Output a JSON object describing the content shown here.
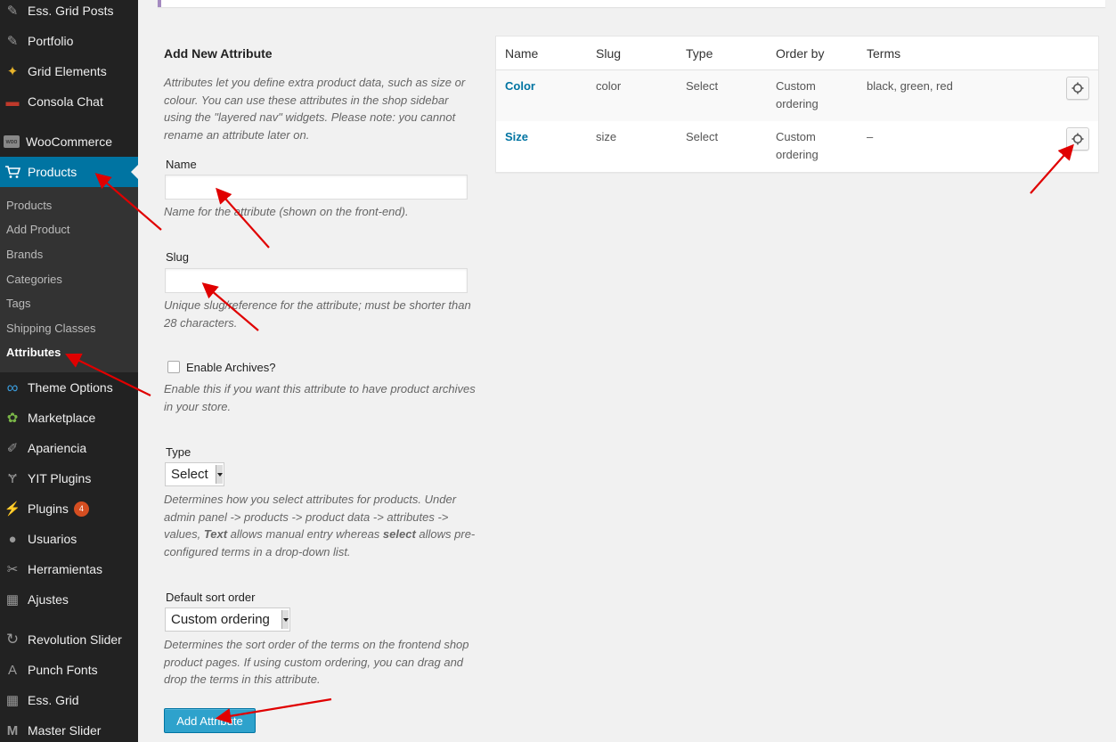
{
  "sidebar": {
    "items": [
      {
        "label": "Ess. Grid Posts",
        "icon": "pin-icon",
        "glyph": "✎"
      },
      {
        "label": "Portfolio",
        "icon": "pin-icon",
        "glyph": "✎"
      },
      {
        "label": "Grid Elements",
        "icon": "grid-elements-icon",
        "glyph": "✦"
      },
      {
        "label": "Consola Chat",
        "icon": "chat-icon",
        "glyph": "▬"
      },
      {
        "label": "WooCommerce",
        "icon": "woocommerce-icon",
        "glyph": "woo"
      },
      {
        "label": "Products",
        "icon": "cart-icon",
        "glyph": "🛒"
      },
      {
        "label": "Theme Options",
        "icon": "theme-options-icon",
        "glyph": "∞"
      },
      {
        "label": "Marketplace",
        "icon": "marketplace-icon",
        "glyph": "✿"
      },
      {
        "label": "Apariencia",
        "icon": "brush-icon",
        "glyph": "✐"
      },
      {
        "label": "YIT Plugins",
        "icon": "yit-icon",
        "glyph": "Ɏ"
      },
      {
        "label": "Plugins",
        "icon": "plugin-icon",
        "glyph": "⚡",
        "badge": "4"
      },
      {
        "label": "Usuarios",
        "icon": "users-icon",
        "glyph": "●"
      },
      {
        "label": "Herramientas",
        "icon": "wrench-icon",
        "glyph": "✂"
      },
      {
        "label": "Ajustes",
        "icon": "settings-icon",
        "glyph": "▦"
      },
      {
        "label": "Revolution Slider",
        "icon": "refresh-icon",
        "glyph": "↻"
      },
      {
        "label": "Punch Fonts",
        "icon": "font-icon",
        "glyph": "A"
      },
      {
        "label": "Ess. Grid",
        "icon": "grid-icon",
        "glyph": "▦"
      },
      {
        "label": "Master Slider",
        "icon": "master-slider-icon",
        "glyph": "M"
      }
    ],
    "submenu": [
      "Products",
      "Add Product",
      "Brands",
      "Categories",
      "Tags",
      "Shipping Classes",
      "Attributes"
    ]
  },
  "form": {
    "title": "Add New Attribute",
    "intro": "Attributes let you define extra product data, such as size or colour. You can use these attributes in the shop sidebar using the \"layered nav\" widgets. Please note: you cannot rename an attribute later on.",
    "name_label": "Name",
    "name_value": "",
    "name_desc": "Name for the attribute (shown on the front-end).",
    "slug_label": "Slug",
    "slug_value": "",
    "slug_desc": "Unique slug/reference for the attribute; must be shorter than 28 characters.",
    "archives_label": "Enable Archives?",
    "archives_desc": "Enable this if you want this attribute to have product archives in your store.",
    "type_label": "Type",
    "type_value": "Select",
    "type_desc_1": "Determines how you select attributes for products. Under admin panel -> products -> product data -> attributes -> values, ",
    "type_desc_bold1": "Text",
    "type_desc_2": " allows manual entry whereas ",
    "type_desc_bold2": "select",
    "type_desc_3": " allows pre-configured terms in a drop-down list.",
    "sort_label": "Default sort order",
    "sort_value": "Custom ordering",
    "sort_desc": "Determines the sort order of the terms on the frontend shop product pages. If using custom ordering, you can drag and drop the terms in this attribute.",
    "submit_label": "Add Attribute"
  },
  "table": {
    "headers": [
      "Name",
      "Slug",
      "Type",
      "Order by",
      "Terms"
    ],
    "rows": [
      {
        "name": "Color",
        "slug": "color",
        "type": "Select",
        "order_1": "Custom",
        "order_2": "ordering",
        "terms": "black, green, red"
      },
      {
        "name": "Size",
        "slug": "size",
        "type": "Select",
        "order_1": "Custom",
        "order_2": "ordering",
        "terms": "–"
      }
    ]
  },
  "colors": {
    "sidebar_bg": "#222222",
    "submenu_bg": "#333333",
    "active_bg": "#0074a2",
    "link": "#0074a2",
    "button": "#2ea2cc",
    "annotation_arrow": "#e00000",
    "badge": "#d54e21"
  }
}
